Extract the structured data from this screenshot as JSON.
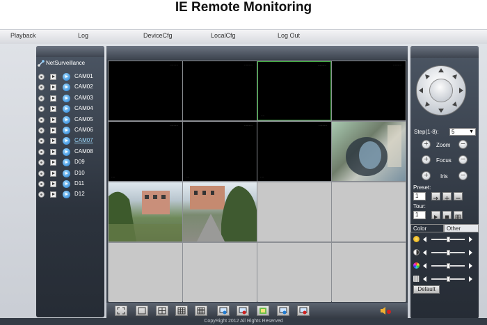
{
  "page_title": "IE Remote Monitoring",
  "menu": [
    "Playback",
    "Log",
    "DeviceCfg",
    "LocalCfg",
    "Log Out"
  ],
  "tree": {
    "root_label": "NetSurveillance",
    "channels": [
      "CAM01",
      "CAM02",
      "CAM03",
      "CAM04",
      "CAM05",
      "CAM06",
      "CAM07",
      "CAM08",
      "D09",
      "D10",
      "D11",
      "D12"
    ],
    "selected_channel": "CAM07"
  },
  "ptz": {
    "step_label": "Step(1-8):",
    "step_value": "5",
    "zoom_label": "Zoom",
    "focus_label": "Focus",
    "iris_label": "Iris",
    "preset_label": "Preset:",
    "preset_value": "1",
    "tour_label": "Tour:",
    "tour_value": "1"
  },
  "color_tabs": {
    "color_label": "Color",
    "other_label": "Other",
    "active": "Color"
  },
  "sliders": {
    "brightness": 0.5,
    "contrast": 0.5,
    "saturation": 0.5,
    "hue": 0.5
  },
  "default_button": "Default",
  "copyright": "CopyRight 2012 All Rights Reserved",
  "colors": {
    "panel_dark": "#2c333d",
    "selected_border": "#3ca83c",
    "grid_gray": "#c8c8c8"
  }
}
